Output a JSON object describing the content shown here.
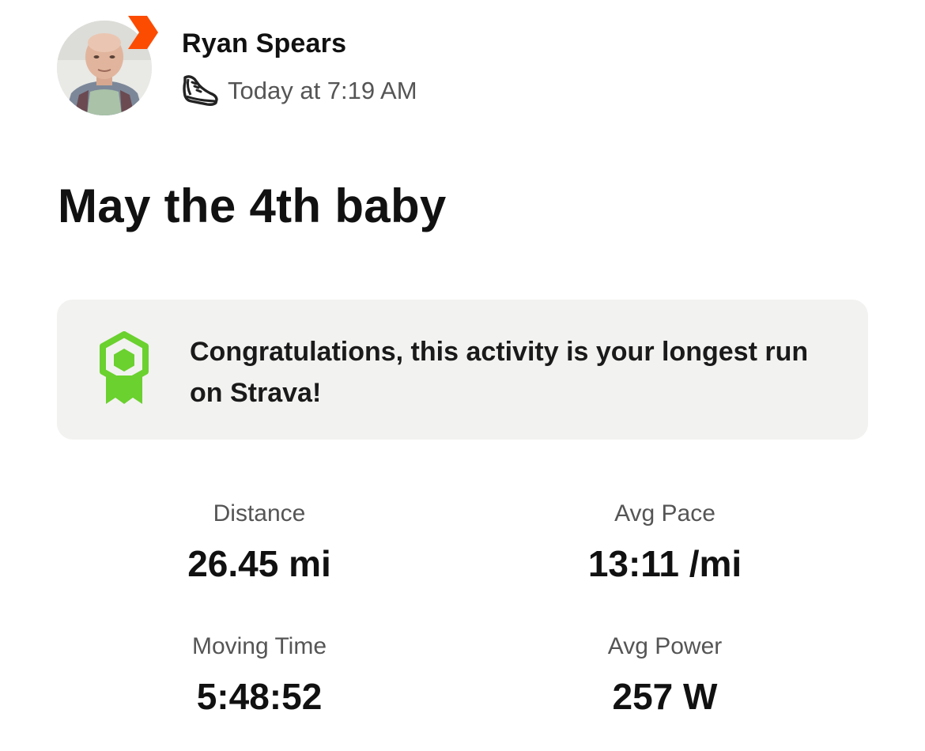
{
  "header": {
    "athlete_name": "Ryan Spears",
    "timestamp": "Today at 7:19 AM",
    "activity_icon": "shoe-icon",
    "avatar": "athlete-avatar",
    "badge_icon": "subscriber-chevron-icon",
    "badge_color": "#fc4c02"
  },
  "activity": {
    "title": "May the 4th baby"
  },
  "achievement": {
    "icon": "medal-icon",
    "icon_color": "#6ad12e",
    "text": "Congratulations, this activity is your longest run on Strava!"
  },
  "stats": [
    {
      "label": "Distance",
      "value": "26.45 mi"
    },
    {
      "label": "Avg Pace",
      "value": "13:11 /mi"
    },
    {
      "label": "Moving Time",
      "value": "5:48:52"
    },
    {
      "label": "Avg Power",
      "value": "257 W"
    }
  ]
}
